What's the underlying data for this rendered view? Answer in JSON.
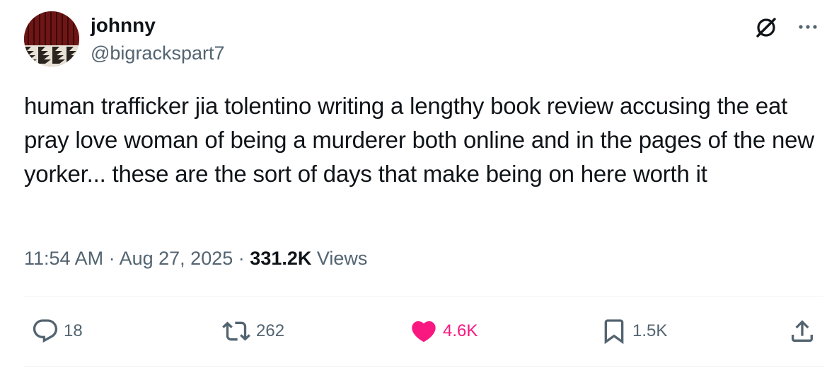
{
  "tweet": {
    "author_name": "johnny",
    "author_handle": "@bigrackspart7",
    "text": "human trafficker jia tolentino writing a lengthy book review accusing the eat pray love woman of being a murderer both online and in the pages of the new yorker... these are the sort of days that make being on here worth it",
    "time": "11:54 AM",
    "date": "Aug 27, 2025",
    "separator": "·",
    "views_count": "331.2K",
    "views_label": "Views"
  },
  "actions": {
    "replies": "18",
    "reposts": "262",
    "likes": "4.6K",
    "bookmarks": "1.5K"
  },
  "colors": {
    "text": "#0f1419",
    "secondary": "#536471",
    "like": "#f91880",
    "divider": "#eff3f4"
  },
  "icons": {
    "grok": "grok-icon",
    "more": "more-icon",
    "reply": "reply-icon",
    "repost": "repost-icon",
    "like": "heart-icon",
    "bookmark": "bookmark-icon",
    "share": "share-icon"
  }
}
